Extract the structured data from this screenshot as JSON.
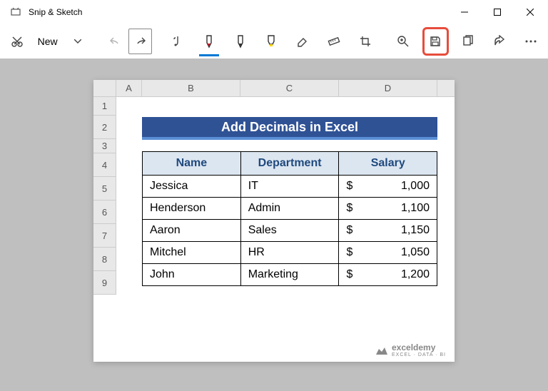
{
  "app": {
    "title": "Snip & Sketch"
  },
  "toolbar": {
    "new_label": "New"
  },
  "excel": {
    "columns": [
      "A",
      "B",
      "C",
      "D"
    ],
    "rows": [
      "1",
      "2",
      "3",
      "4",
      "5",
      "6",
      "7",
      "8",
      "9"
    ],
    "title": "Add Decimals in Excel",
    "headers": {
      "name": "Name",
      "department": "Department",
      "salary": "Salary"
    },
    "data": [
      {
        "name": "Jessica",
        "dept": "IT",
        "salary": "1,000"
      },
      {
        "name": "Henderson",
        "dept": "Admin",
        "salary": "1,100"
      },
      {
        "name": "Aaron",
        "dept": "Sales",
        "salary": "1,150"
      },
      {
        "name": "Mitchel",
        "dept": "HR",
        "salary": "1,050"
      },
      {
        "name": "John",
        "dept": "Marketing",
        "salary": "1,200"
      }
    ],
    "currency": "$"
  },
  "watermark": {
    "brand": "exceldemy",
    "tagline": "EXCEL · DATA · BI"
  }
}
